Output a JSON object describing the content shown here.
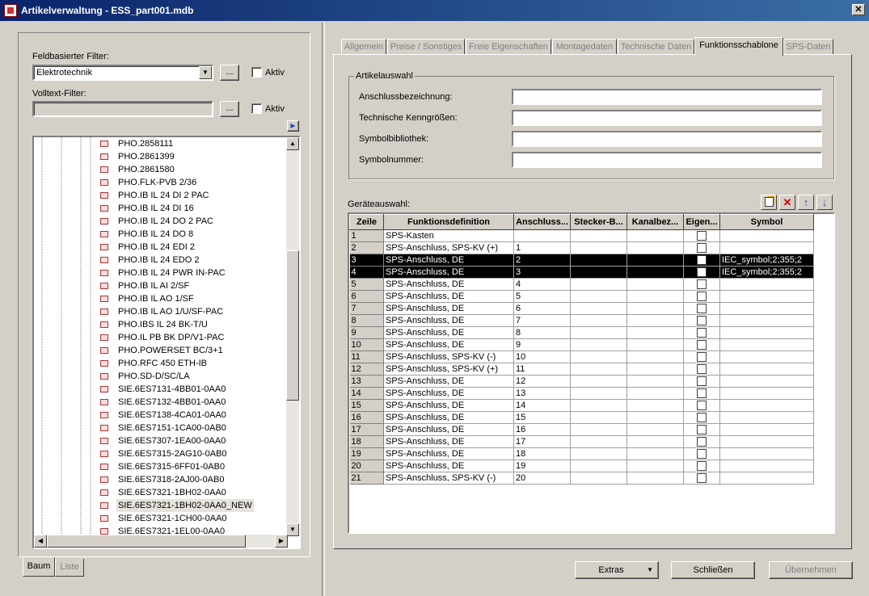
{
  "window": {
    "title": "Artikelverwaltung - ESS_part001.mdb"
  },
  "left": {
    "field_filter": {
      "label": "Feldbasierter Filter:",
      "value": "Elektrotechnik",
      "browse": "...",
      "active_label": "Aktiv"
    },
    "text_filter": {
      "label": "Volltext-Filter:",
      "value": "",
      "browse": "...",
      "active_label": "Aktiv"
    },
    "tree_items": [
      "PHO.2858111",
      "PHO.2861399",
      "PHO.2861580",
      "PHO.FLK-PVB 2/36",
      "PHO.IB IL 24 DI 2 PAC",
      "PHO.IB IL 24 DI 16",
      "PHO.IB IL 24 DO 2 PAC",
      "PHO.IB IL 24 DO 8",
      "PHO.IB IL 24 EDI 2",
      "PHO.IB IL 24 EDO 2",
      "PHO.IB IL 24 PWR IN-PAC",
      "PHO.IB IL AI 2/SF",
      "PHO.IB IL AO 1/SF",
      "PHO.IB IL AO 1/U/SF-PAC",
      "PHO.IBS IL 24 BK-T/U",
      "PHO.IL PB BK DP/V1-PAC",
      "PHO.POWERSET BC/3+1",
      "PHO.RFC 450 ETH-IB",
      "PHO.SD-D/SC/LA",
      "SIE.6ES7131-4BB01-0AA0",
      "SIE.6ES7132-4BB01-0AA0",
      "SIE.6ES7138-4CA01-0AA0",
      "SIE.6ES7151-1CA00-0AB0",
      "SIE.6ES7307-1EA00-0AA0",
      "SIE.6ES7315-2AG10-0AB0",
      "SIE.6ES7315-6FF01-0AB0",
      "SIE.6ES7318-2AJ00-0AB0",
      "SIE.6ES7321-1BH02-0AA0",
      "SIE.6ES7321-1BH02-0AA0_NEW",
      "SIE.6ES7321-1CH00-0AA0",
      "SIE.6ES7321-1EL00-0AA0"
    ],
    "selected_item": "SIE.6ES7321-1BH02-0AA0_NEW",
    "bottom_tabs": [
      "Baum",
      "Liste"
    ]
  },
  "tabs": [
    "Allgemein",
    "Preise / Sonstiges",
    "Freie Eigenschaften",
    "Montagedaten",
    "Technische Daten",
    "Funktionsschablone",
    "SPS-Daten"
  ],
  "active_tab": "Funktionsschablone",
  "artikelauswahl": {
    "title": "Artikelauswahl",
    "fields": [
      {
        "label": "Anschlussbezeichnung:",
        "value": ""
      },
      {
        "label": "Technische Kenngrößen:",
        "value": ""
      },
      {
        "label": "Symbolbibliothek:",
        "value": ""
      },
      {
        "label": "Symbolnummer:",
        "value": ""
      }
    ]
  },
  "geraeteauswahl": {
    "label": "Geräteauswahl:",
    "columns": [
      "Zeile",
      "Funktionsdefinition",
      "Anschluss...",
      "Stecker-B...",
      "Kanalbez...",
      "Eigen...",
      "Symbol"
    ],
    "rows": [
      {
        "z": "1",
        "f": "SPS-Kasten",
        "a": "",
        "s": "",
        "k": "",
        "sym": ""
      },
      {
        "z": "2",
        "f": "SPS-Anschluss, SPS-KV (+)",
        "a": "1",
        "s": "",
        "k": "",
        "sym": ""
      },
      {
        "z": "3",
        "f": "SPS-Anschluss, DE",
        "a": "2",
        "s": "",
        "k": "",
        "sym": "IEC_symbol;2;355;2"
      },
      {
        "z": "4",
        "f": "SPS-Anschluss, DE",
        "a": "3",
        "s": "",
        "k": "",
        "sym": "IEC_symbol;2;355;2"
      },
      {
        "z": "5",
        "f": "SPS-Anschluss, DE",
        "a": "4",
        "s": "",
        "k": "",
        "sym": ""
      },
      {
        "z": "6",
        "f": "SPS-Anschluss, DE",
        "a": "5",
        "s": "",
        "k": "",
        "sym": ""
      },
      {
        "z": "7",
        "f": "SPS-Anschluss, DE",
        "a": "6",
        "s": "",
        "k": "",
        "sym": ""
      },
      {
        "z": "8",
        "f": "SPS-Anschluss, DE",
        "a": "7",
        "s": "",
        "k": "",
        "sym": ""
      },
      {
        "z": "9",
        "f": "SPS-Anschluss, DE",
        "a": "8",
        "s": "",
        "k": "",
        "sym": ""
      },
      {
        "z": "10",
        "f": "SPS-Anschluss, DE",
        "a": "9",
        "s": "",
        "k": "",
        "sym": ""
      },
      {
        "z": "11",
        "f": "SPS-Anschluss, SPS-KV (-)",
        "a": "10",
        "s": "",
        "k": "",
        "sym": ""
      },
      {
        "z": "12",
        "f": "SPS-Anschluss, SPS-KV (+)",
        "a": "11",
        "s": "",
        "k": "",
        "sym": ""
      },
      {
        "z": "13",
        "f": "SPS-Anschluss, DE",
        "a": "12",
        "s": "",
        "k": "",
        "sym": ""
      },
      {
        "z": "14",
        "f": "SPS-Anschluss, DE",
        "a": "13",
        "s": "",
        "k": "",
        "sym": ""
      },
      {
        "z": "15",
        "f": "SPS-Anschluss, DE",
        "a": "14",
        "s": "",
        "k": "",
        "sym": ""
      },
      {
        "z": "16",
        "f": "SPS-Anschluss, DE",
        "a": "15",
        "s": "",
        "k": "",
        "sym": ""
      },
      {
        "z": "17",
        "f": "SPS-Anschluss, DE",
        "a": "16",
        "s": "",
        "k": "",
        "sym": ""
      },
      {
        "z": "18",
        "f": "SPS-Anschluss, DE",
        "a": "17",
        "s": "",
        "k": "",
        "sym": ""
      },
      {
        "z": "19",
        "f": "SPS-Anschluss, DE",
        "a": "18",
        "s": "",
        "k": "",
        "sym": ""
      },
      {
        "z": "20",
        "f": "SPS-Anschluss, DE",
        "a": "19",
        "s": "",
        "k": "",
        "sym": ""
      },
      {
        "z": "21",
        "f": "SPS-Anschluss, SPS-KV (-)",
        "a": "20",
        "s": "",
        "k": "",
        "sym": ""
      }
    ],
    "selected_rows": [
      "3",
      "4"
    ]
  },
  "buttons": {
    "extras": "Extras",
    "close": "Schließen",
    "apply": "Übernehmen"
  },
  "colors": {
    "title_bar": "#0a246a",
    "selection": "#000000",
    "face": "#d4d0c8",
    "delete_icon": "#cc0000",
    "move_icon": "#1a4fd0"
  },
  "icons": [
    "new-row-icon",
    "delete-row-icon",
    "move-up-icon",
    "move-down-icon",
    "expand-arrow-icon"
  ]
}
